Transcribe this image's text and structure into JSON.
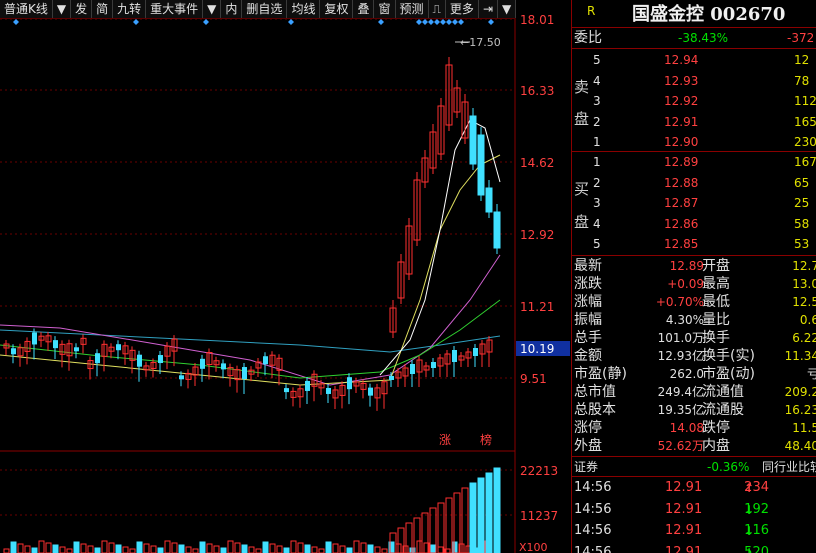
{
  "toolbar": {
    "items": [
      "普通K线",
      "▼",
      "发",
      "简",
      "九转",
      "重大事件",
      "▼",
      "内",
      "删自选",
      "均线",
      "复权",
      "叠",
      "窗",
      "预测",
      "⎍",
      "更多",
      "⇥",
      "▼"
    ]
  },
  "chart": {
    "price_labels": [
      "18.01",
      "16.33",
      "14.62",
      "12.92",
      "11.21",
      "9.51"
    ],
    "current_price": "10.19",
    "high_marker": "17.50",
    "volume_labels": [
      "22213",
      "11237"
    ],
    "volume_unit": "X100",
    "tags": [
      "涨",
      "榜"
    ]
  },
  "header": {
    "flag": "R",
    "name": "国盛金控",
    "code": "002670"
  },
  "weibi": {
    "label": "委比",
    "pct": "-38.43%",
    "diff": "-372"
  },
  "sell_label": [
    "卖",
    "盘"
  ],
  "buy_label": [
    "买",
    "盘"
  ],
  "asks": [
    {
      "lvl": "5",
      "price": "12.94",
      "vol": "12"
    },
    {
      "lvl": "4",
      "price": "12.93",
      "vol": "78"
    },
    {
      "lvl": "3",
      "price": "12.92",
      "vol": "112"
    },
    {
      "lvl": "2",
      "price": "12.91",
      "vol": "165"
    },
    {
      "lvl": "1",
      "price": "12.90",
      "vol": "230"
    }
  ],
  "bids": [
    {
      "lvl": "1",
      "price": "12.89",
      "vol": "167"
    },
    {
      "lvl": "2",
      "price": "12.88",
      "vol": "65"
    },
    {
      "lvl": "3",
      "price": "12.87",
      "vol": "25"
    },
    {
      "lvl": "4",
      "price": "12.86",
      "vol": "58"
    },
    {
      "lvl": "5",
      "price": "12.85",
      "vol": "53"
    }
  ],
  "stats": [
    {
      "l1": "最新",
      "v1": "12.89",
      "c1": "red",
      "l2": "开盘",
      "v2": "12.7"
    },
    {
      "l1": "涨跌",
      "v1": "+0.09",
      "c1": "red",
      "l2": "最高",
      "v2": "13.0"
    },
    {
      "l1": "涨幅",
      "v1": "+0.70%",
      "c1": "red",
      "l2": "最低",
      "v2": "12.5"
    },
    {
      "l1": "振幅",
      "v1": "4.30%",
      "c1": "white",
      "l2": "量比",
      "v2": "0.6"
    },
    {
      "l1": "总手",
      "v1": "101.0万",
      "c1": "white",
      "l2": "换手",
      "v2": "6.22"
    },
    {
      "l1": "金额",
      "v1": "12.93亿",
      "c1": "white",
      "l2": "换手(实)",
      "v2": "11.34"
    },
    {
      "l1": "市盈(静)",
      "v1": "262.0",
      "c1": "white",
      "l2": "市盈(动)",
      "v2": "亏"
    },
    {
      "l1": "总市值",
      "v1": "249.4亿",
      "c1": "white",
      "l2": "流通值",
      "v2": "209.2"
    },
    {
      "l1": "总股本",
      "v1": "19.35亿",
      "c1": "white",
      "l2": "流通股",
      "v2": "16.23"
    },
    {
      "l1": "涨停",
      "v1": "14.08",
      "c1": "red",
      "l2": "跌停",
      "v2": "11.5"
    },
    {
      "l1": "外盘",
      "v1": "52.62万",
      "c1": "red",
      "l2": "内盘",
      "v2": "48.40"
    }
  ],
  "sector": {
    "label": "证券",
    "pct": "-0.36%",
    "link": "同行业比较"
  },
  "ticks": [
    {
      "time": "14:56",
      "price": "12.91",
      "vol": "234",
      "dir": "↑",
      "color": "red"
    },
    {
      "time": "14:56",
      "price": "12.91",
      "vol": "192",
      "dir": "↓",
      "color": "green"
    },
    {
      "time": "14:56",
      "price": "12.91",
      "vol": "116",
      "dir": "↓",
      "color": "green"
    },
    {
      "time": "14:56",
      "price": "12.91",
      "vol": "520",
      "dir": "↓",
      "color": "green"
    }
  ]
}
